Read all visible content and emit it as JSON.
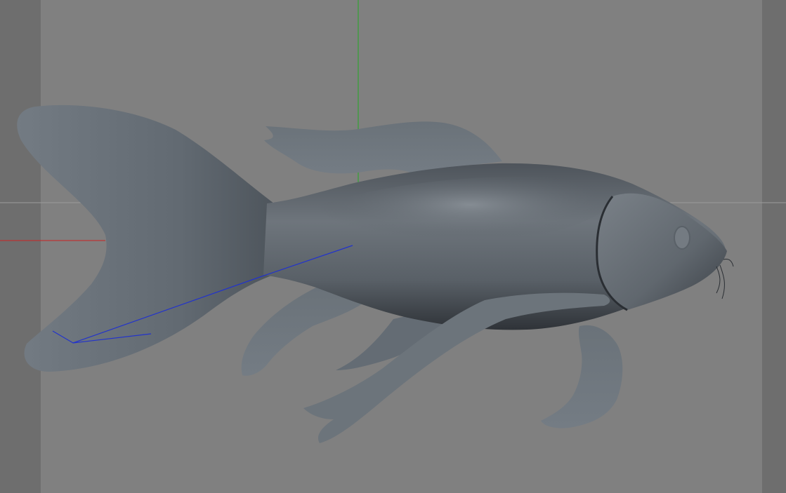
{
  "viewport": {
    "background": "#808080",
    "mask_color": "#6e6e6e",
    "axis_colors": {
      "x": "#cc2222",
      "y": "#22aa22",
      "horizon": "#9a9a9a"
    }
  },
  "model": {
    "object": "fish",
    "fill": "#5f666e",
    "shadow": "#3a3f45",
    "highlight": "#8a9198"
  },
  "bone_chain_color": "#2233cc"
}
